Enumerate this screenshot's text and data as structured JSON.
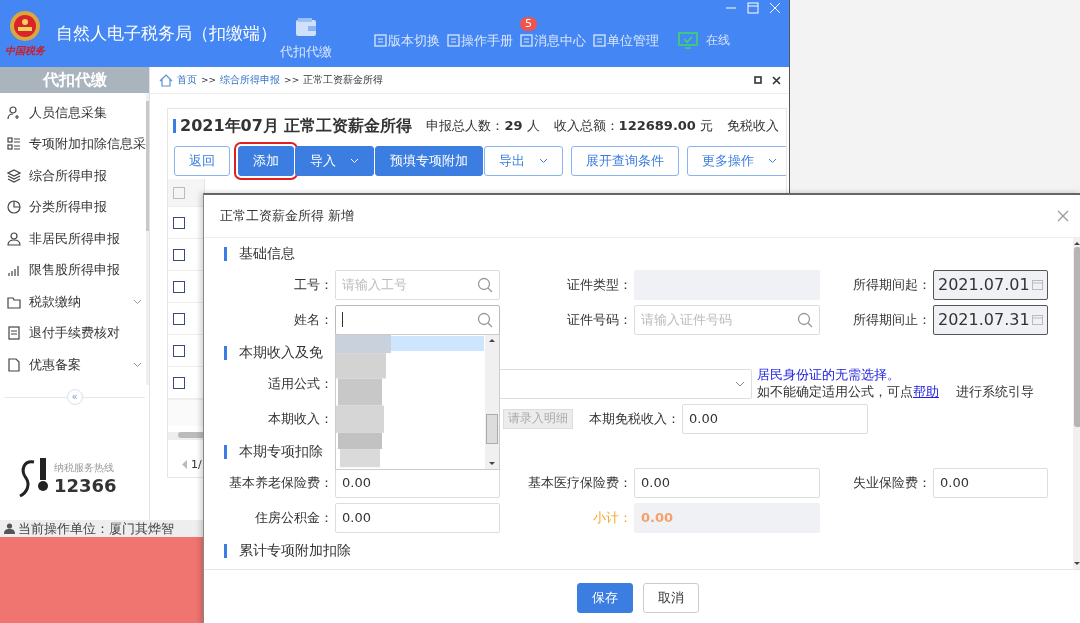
{
  "app": {
    "logo_text": "中国税务",
    "title": "自然人电子税务局（扣缴端）",
    "module": "代扣代缴",
    "links": [
      {
        "label": "版本切换"
      },
      {
        "label": "操作手册"
      },
      {
        "label": "消息中心",
        "badge": "5"
      },
      {
        "label": "单位管理"
      }
    ],
    "status": "在线"
  },
  "sidebar": {
    "title": "代扣代缴",
    "items": [
      {
        "label": "人员信息采集",
        "kind": "person-add",
        "expandable": false
      },
      {
        "label": "专项附加扣除信息采",
        "kind": "list",
        "expandable": false
      },
      {
        "label": "综合所得申报",
        "kind": "layers",
        "expandable": false
      },
      {
        "label": "分类所得申报",
        "kind": "pie",
        "expandable": false
      },
      {
        "label": "非居民所得申报",
        "kind": "person",
        "expandable": false
      },
      {
        "label": "限售股所得申报",
        "kind": "bars",
        "expandable": false
      },
      {
        "label": "税款缴纳",
        "kind": "folder",
        "expandable": true
      },
      {
        "label": "退付手续费核对",
        "kind": "doc",
        "expandable": false
      },
      {
        "label": "优惠备案",
        "kind": "page",
        "expandable": true
      }
    ],
    "collapse": "«",
    "hotline_label": "纳税服务热线",
    "hotline": "12366"
  },
  "status_bar": "当前操作单位：厦门其烨智",
  "breadcrumb": [
    {
      "text": "首页",
      "kind": "link"
    },
    {
      "text": ">>",
      "kind": "sep"
    },
    {
      "text": "综合所得申报",
      "kind": "link"
    },
    {
      "text": ">>",
      "kind": "sep"
    },
    {
      "text": "正常工资薪金所得",
      "kind": "current"
    }
  ],
  "panel": {
    "title": "2021年07月 正常工资薪金所得",
    "stats": [
      "申报总人数：**29** 人",
      "收入总额：**122689.00** 元",
      "免税收入"
    ],
    "buttons": [
      {
        "label": "返回",
        "kind": "outline",
        "dropdown": false,
        "highlighted": false
      },
      {
        "label": "添加",
        "kind": "primary",
        "dropdown": false,
        "highlighted": true
      },
      {
        "label": "导入",
        "kind": "primary",
        "dropdown": true,
        "highlighted": false
      },
      {
        "label": "预填专项附加",
        "kind": "primary",
        "dropdown": false,
        "highlighted": false
      },
      {
        "label": "导出",
        "kind": "outline",
        "dropdown": true,
        "highlighted": false
      },
      {
        "label": "展开查询条件",
        "kind": "outline",
        "dropdown": false,
        "highlighted": false
      },
      {
        "label": "更多操作",
        "kind": "outline",
        "dropdown": true,
        "highlighted": false
      }
    ]
  },
  "table": {
    "header_checked": false,
    "rows": [
      {
        "checked": false
      },
      {
        "checked": false
      },
      {
        "checked": false
      },
      {
        "checked": false
      },
      {
        "checked": false
      },
      {
        "checked": false
      }
    ],
    "pager": "1/"
  },
  "dialog": {
    "title": "正常工资薪金所得 新增",
    "sections": [
      {
        "title": "基础信息",
        "rows": [
          [
            {
              "label": "工号：",
              "kind": "search",
              "placeholder": "请输入工号"
            },
            {
              "label": "证件类型：",
              "kind": "disabled"
            },
            {
              "label": "所得期间起：",
              "kind": "date",
              "value": "2021.07.01"
            }
          ],
          [
            {
              "label": "姓名：",
              "kind": "search",
              "focused": true,
              "dropdown": true
            },
            {
              "label": "证件号码：",
              "kind": "search",
              "placeholder": "请输入证件号码"
            },
            {
              "label": "所得期间止：",
              "kind": "date",
              "value": "2021.07.31"
            }
          ]
        ]
      },
      {
        "title": "本期收入及免",
        "rows": [
          [
            {
              "label": "适用公式：",
              "kind": "select",
              "help": "居民身份证的无需选择。",
              "hint": "如不能确定适用公式，可点",
              "link": "帮助",
              "hint_after": "进行系统引导"
            }
          ],
          [
            {
              "label": "本期收入：",
              "kind": "income",
              "button": "请录入明细"
            },
            {
              "label": "本期免税收入：",
              "kind": "text",
              "value": "0.00"
            }
          ]
        ]
      },
      {
        "title": "本期专项扣除",
        "rows": [
          [
            {
              "label": "基本养老保险费：",
              "kind": "text",
              "value": "0.00"
            },
            {
              "label": "基本医疗保险费：",
              "kind": "text",
              "value": "0.00"
            },
            {
              "label": "失业保险费：",
              "kind": "text",
              "value": "0.00"
            }
          ],
          [
            {
              "label": "住房公积金：",
              "kind": "text",
              "value": "0.00"
            },
            {
              "label": "小计：",
              "kind": "subtotal",
              "value": "0.00"
            }
          ]
        ]
      },
      {
        "title": "累计专项附加扣除"
      }
    ],
    "buttons": [
      {
        "label": "保存",
        "kind": "primary"
      },
      {
        "label": "取消",
        "kind": "plain"
      }
    ]
  }
}
